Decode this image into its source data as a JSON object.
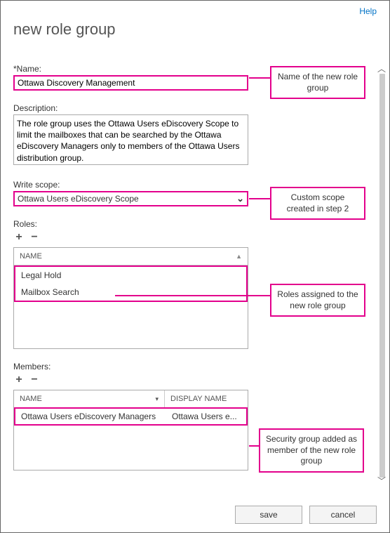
{
  "help_label": "Help",
  "page_title": "new role group",
  "name": {
    "label": "*Name:",
    "value": "Ottawa Discovery Management"
  },
  "description": {
    "label": "Description:",
    "value": "The role group uses the Ottawa Users eDiscovery Scope to limit the mailboxes that can be searched by the Ottawa eDiscovery Managers only to members of the Ottawa Users distribution group."
  },
  "write_scope": {
    "label": "Write scope:",
    "selected": "Ottawa Users eDiscovery Scope"
  },
  "roles": {
    "label": "Roles:",
    "header": "NAME",
    "items": [
      "Legal Hold",
      "Mailbox Search"
    ]
  },
  "members": {
    "label": "Members:",
    "headers": [
      "NAME",
      "DISPLAY NAME"
    ],
    "rows": [
      {
        "name": "Ottawa Users eDiscovery Managers",
        "display": "Ottawa Users e..."
      }
    ]
  },
  "annotations": {
    "name": "Name of the new role group",
    "scope": "Custom scope created in step 2",
    "roles": "Roles assigned to the new role group",
    "members": "Security group added as member of the new role group"
  },
  "buttons": {
    "save": "save",
    "cancel": "cancel"
  },
  "icons": {
    "plus": "+",
    "minus": "−",
    "sort_asc": "▲",
    "dropdown": "▼",
    "col_div": "▾",
    "scroll_up": "︿",
    "scroll_down": "﹀"
  }
}
